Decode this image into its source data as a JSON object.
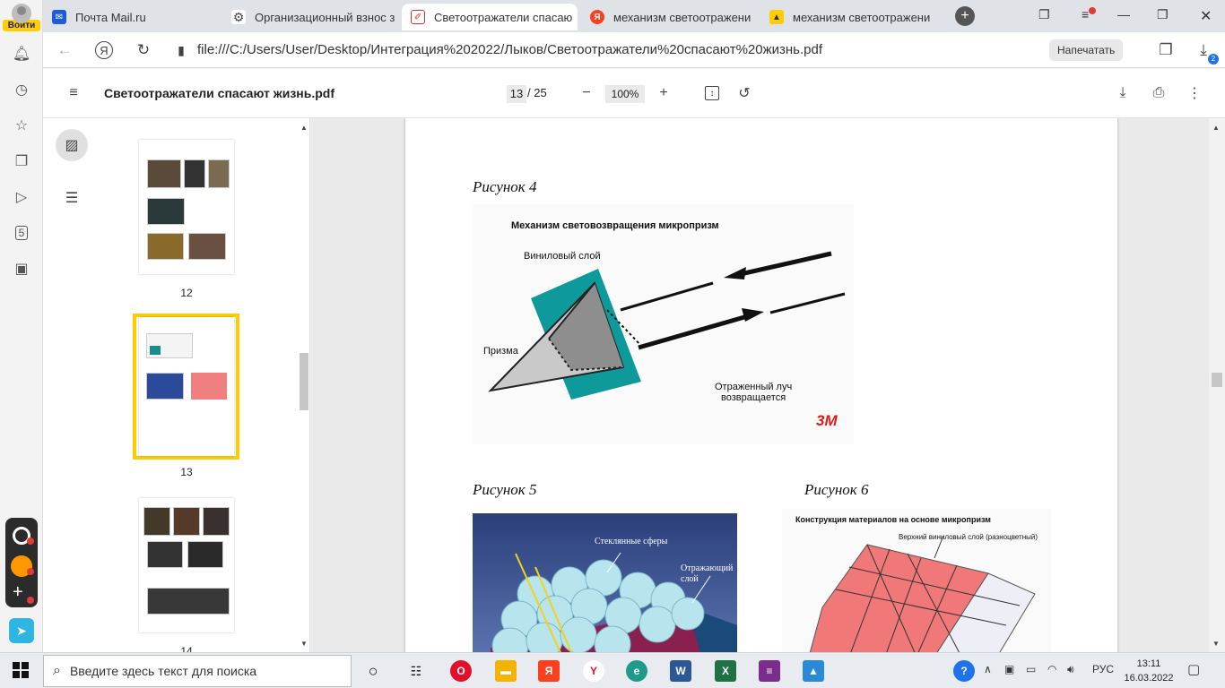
{
  "sidebar": {
    "login_label": "Войти",
    "items": [
      "bell-icon",
      "history-icon",
      "star-icon",
      "collections-icon",
      "play-icon",
      "five-icon",
      "camera-icon"
    ]
  },
  "tabs": [
    {
      "label": "Почта Mail.ru",
      "icon": "mail-icon",
      "color": "#1e5bd9"
    },
    {
      "label": "Организационный взнос з",
      "icon": "gear-icon",
      "color": "#444444"
    },
    {
      "label": "Светоотражатели спасаю",
      "icon": "pdf-icon",
      "color": "#d93025",
      "active": true
    },
    {
      "label": "механизм светоотражени",
      "icon": "yandex-icon",
      "color": "#fc3f1d"
    },
    {
      "label": "механизм светоотражени",
      "icon": "images-icon",
      "color": "#ffcc00"
    }
  ],
  "address": {
    "url": "file:///C:/Users/User/Desktop/Интеграция%202022/Лыков/Светоотражатели%20спасают%20жизнь.pdf",
    "print_label": "Напечатать",
    "downloads_count": "2"
  },
  "pdf": {
    "title": "Светоотражатели спасают жизнь.pdf",
    "current_page": "13",
    "total_pages": "/ 25",
    "zoom": "100%"
  },
  "thumbnails": [
    {
      "number": "12"
    },
    {
      "number": "13",
      "selected": true
    },
    {
      "number": "14"
    }
  ],
  "page_content": {
    "figure4_caption": "Рисунок  4",
    "figure5_caption": "Рисунок  5",
    "figure6_caption": "Рисунок  6",
    "fig4": {
      "title": "Механизм световозвращения микропризм",
      "vinyl_label": "Виниловый слой",
      "prism_label": "Призма",
      "reflected_label_1": "Отраженный луч",
      "reflected_label_2": "возвращается",
      "logo": "3M"
    },
    "fig5": {
      "spheres_label": "Стеклянные сферы",
      "reflect_label_1": "Отражающий",
      "reflect_label_2": "слой"
    },
    "fig6": {
      "title": "Конструкция материалов на основе микропризм",
      "top_layer_label": "Верхний виниловый слой (разноцветный)"
    }
  },
  "taskbar": {
    "search_placeholder": "Введите здесь текст для поиска",
    "lang": "РУС",
    "time": "13:11",
    "date": "16.03.2022"
  }
}
